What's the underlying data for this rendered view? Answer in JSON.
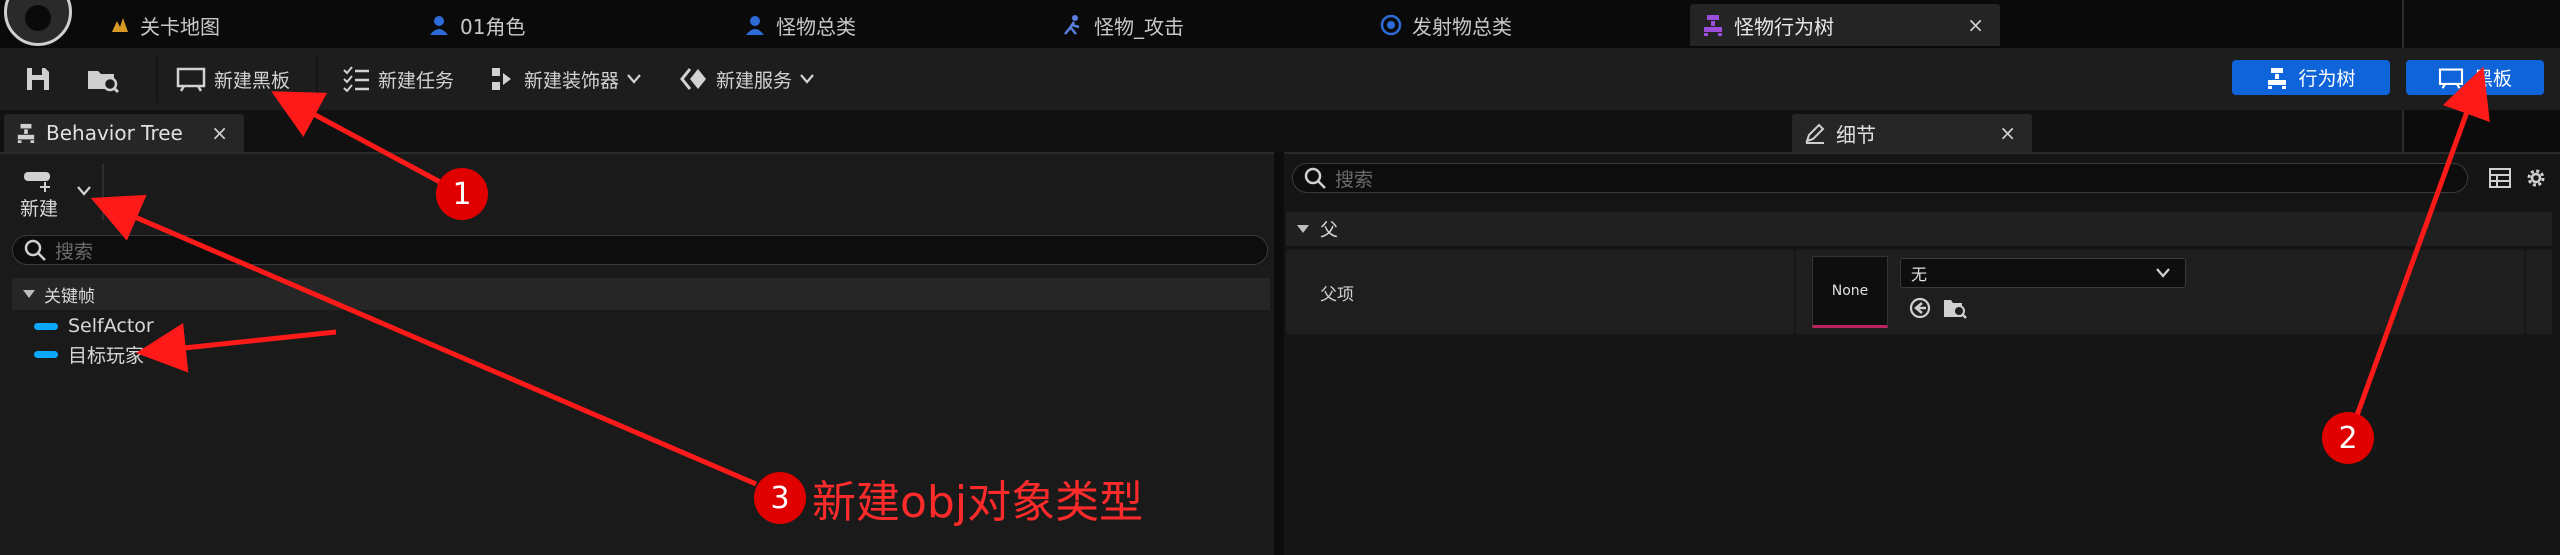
{
  "tabs": [
    {
      "label": "关卡地图",
      "icon": "level-map-icon"
    },
    {
      "label": "01角色",
      "icon": "character-blueprint-icon"
    },
    {
      "label": "怪物总类",
      "icon": "character-blueprint-icon"
    },
    {
      "label": "怪物_攻击",
      "icon": "anim-montage-icon"
    },
    {
      "label": "发射物总类",
      "icon": "actor-blueprint-icon"
    },
    {
      "label": "怪物行为树",
      "icon": "behavior-tree-icon",
      "close": "×"
    }
  ],
  "toolbar": {
    "new_blackboard": "新建黑板",
    "new_task": "新建任务",
    "new_decorator": "新建装饰器",
    "new_service": "新建服务",
    "behavior_tree": "行为树",
    "blackboard": "黑板"
  },
  "panels": {
    "behavior_tree_tab": "Behavior Tree",
    "details_tab": "细节",
    "close": "×"
  },
  "blackboard": {
    "new_label": "新建",
    "search_placeholder": "搜索",
    "category": "关键帧",
    "keys": [
      "SelfActor",
      "目标玩家"
    ]
  },
  "details": {
    "search_placeholder": "搜索",
    "section": "父",
    "parent_label": "父项",
    "thumbnail": "None",
    "dropdown_value": "无"
  },
  "annotations": {
    "one": "1",
    "two": "2",
    "three": "3",
    "note": "新建obj对象类型"
  },
  "colors": {
    "accent_blue": "#0f64d9",
    "key_color": "#0aa8ff",
    "annotation_red": "#e00000"
  }
}
